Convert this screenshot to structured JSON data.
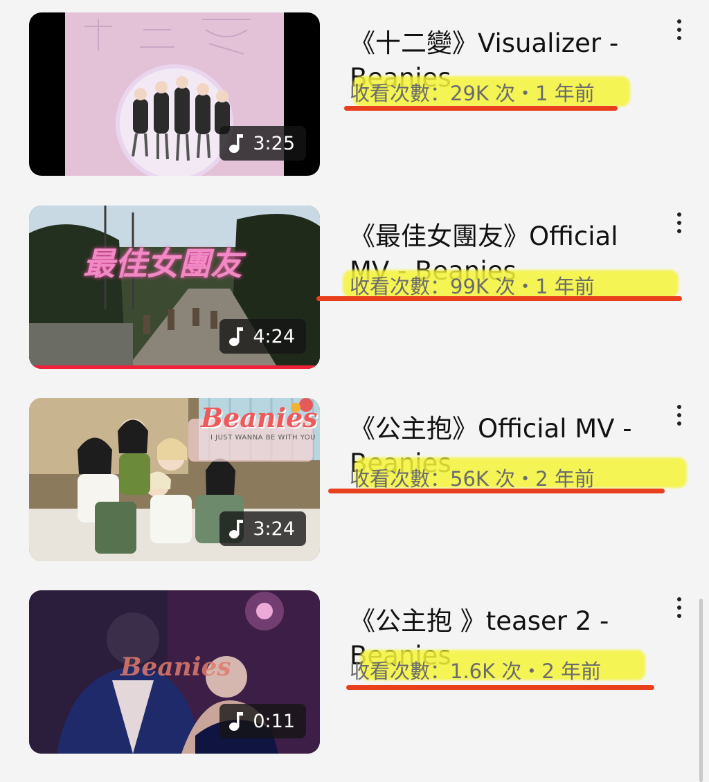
{
  "videos": [
    {
      "title": "《十二變》Visualizer - Beanies",
      "meta": "收看次數：29K 次・1 年前",
      "duration": "3:25",
      "thumbnail_text": "十二變",
      "watch_progress": 0
    },
    {
      "title": "《最佳女團友》Official MV - Beanies",
      "meta": "收看次數：99K 次・1 年前",
      "duration": "4:24",
      "thumbnail_text": "最佳女團友",
      "watch_progress": 1.0
    },
    {
      "title": "《公主抱》Official MV - Beanies",
      "meta": "收看次數：56K 次・2 年前",
      "duration": "3:24",
      "thumbnail_text": "Beanies",
      "thumbnail_subtext": "I JUST WANNA BE WITH YOU",
      "watch_progress": 0
    },
    {
      "title": "《公主抱 》teaser 2 - Beanies",
      "meta": "收看次數：1.6K 次・2 年前",
      "duration": "0:11",
      "thumbnail_text": "Beanies",
      "watch_progress": 0
    }
  ],
  "icons": {
    "duration": "music-note-icon",
    "menu": "more-vert-icon"
  },
  "colors": {
    "highlight": "#f6f43a",
    "underline": "#e8401c",
    "progress": "#f2213a"
  }
}
